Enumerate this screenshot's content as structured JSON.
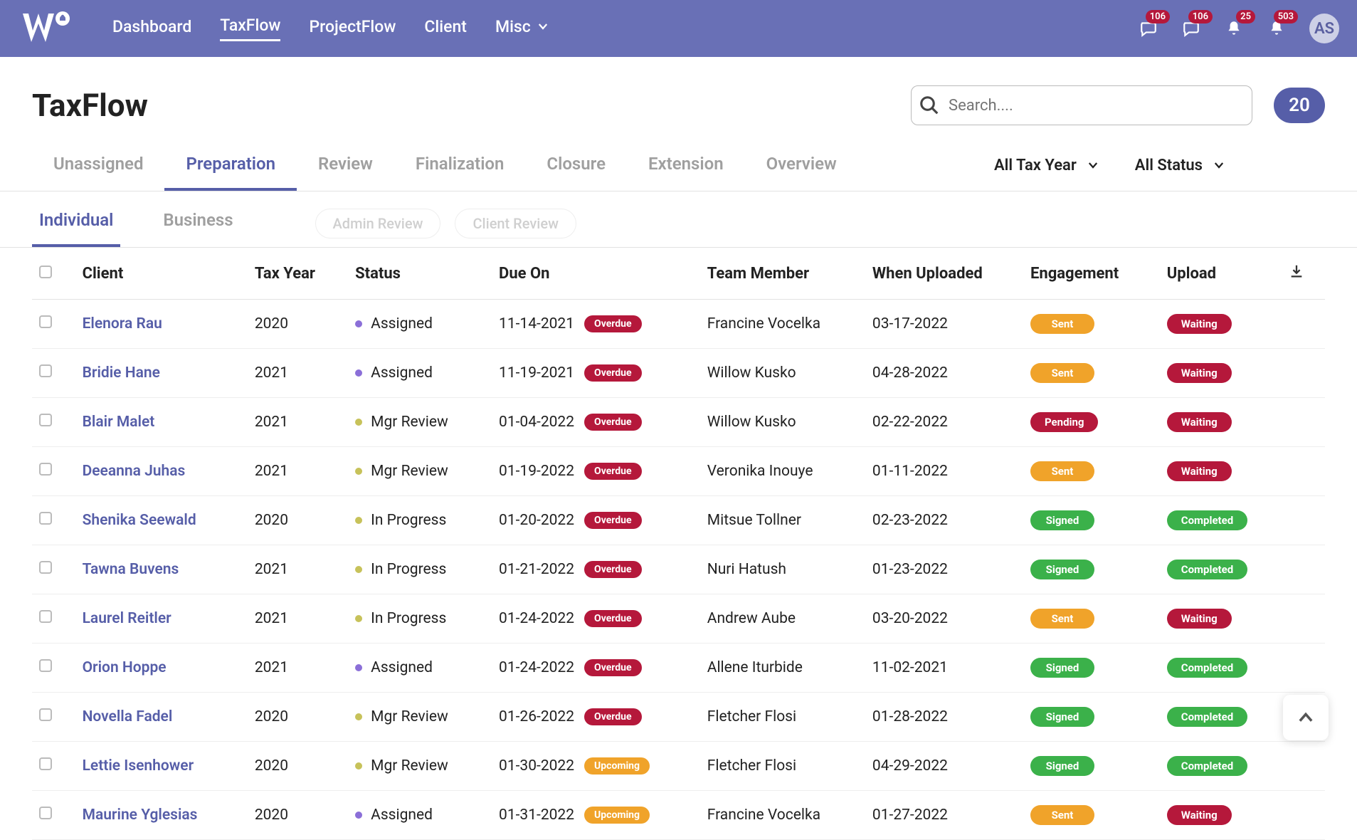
{
  "top": {
    "nav": [
      "Dashboard",
      "TaxFlow",
      "ProjectFlow",
      "Client",
      "Misc"
    ],
    "active": "TaxFlow",
    "badges": [
      {
        "icon": "chat-icon",
        "count": "106"
      },
      {
        "icon": "chat2-icon",
        "count": "106"
      },
      {
        "icon": "bell-icon",
        "count": "25"
      },
      {
        "icon": "bell2-icon",
        "count": "503"
      }
    ],
    "avatar": "AS"
  },
  "page": {
    "title": "TaxFlow",
    "search_placeholder": "Search....",
    "count": "20"
  },
  "mainTabs": [
    "Unassigned",
    "Preparation",
    "Review",
    "Finalization",
    "Closure",
    "Extension",
    "Overview"
  ],
  "mainActive": "Preparation",
  "filters": {
    "year": "All Tax Year",
    "status": "All Status"
  },
  "subTabs": [
    "Individual",
    "Business"
  ],
  "subActive": "Individual",
  "pillTabs": [
    "Admin Review",
    "Client Review"
  ],
  "columns": [
    "Client",
    "Tax Year",
    "Status",
    "Due On",
    "Team Member",
    "When Uploaded",
    "Engagement",
    "Upload"
  ],
  "badgeLabels": {
    "overdue": "Overdue",
    "upcoming": "Upcoming",
    "sent": "Sent",
    "pending": "Pending",
    "signed": "Signed",
    "waiting": "Waiting",
    "completed": "Completed"
  },
  "rows": [
    {
      "client": "Elenora Rau",
      "year": "2020",
      "status": "Assigned",
      "dot": "purple",
      "due": "11-14-2021",
      "dueBadge": "overdue",
      "member": "Francine Vocelka",
      "uploaded": "03-17-2022",
      "eng": "sent",
      "upl": "waiting"
    },
    {
      "client": "Bridie Hane",
      "year": "2021",
      "status": "Assigned",
      "dot": "purple",
      "due": "11-19-2021",
      "dueBadge": "overdue",
      "member": "Willow Kusko",
      "uploaded": "04-28-2022",
      "eng": "sent",
      "upl": "waiting"
    },
    {
      "client": "Blair Malet",
      "year": "2021",
      "status": "Mgr Review",
      "dot": "olive",
      "due": "01-04-2022",
      "dueBadge": "overdue",
      "member": "Willow Kusko",
      "uploaded": "02-22-2022",
      "eng": "pending",
      "upl": "waiting"
    },
    {
      "client": "Deeanna Juhas",
      "year": "2021",
      "status": "Mgr Review",
      "dot": "olive",
      "due": "01-19-2022",
      "dueBadge": "overdue",
      "member": "Veronika Inouye",
      "uploaded": "01-11-2022",
      "eng": "sent",
      "upl": "waiting"
    },
    {
      "client": "Shenika Seewald",
      "year": "2020",
      "status": "In Progress",
      "dot": "olive",
      "due": "01-20-2022",
      "dueBadge": "overdue",
      "member": "Mitsue Tollner",
      "uploaded": "02-23-2022",
      "eng": "signed",
      "upl": "completed"
    },
    {
      "client": "Tawna Buvens",
      "year": "2021",
      "status": "In Progress",
      "dot": "olive",
      "due": "01-21-2022",
      "dueBadge": "overdue",
      "member": "Nuri Hatush",
      "uploaded": "01-23-2022",
      "eng": "signed",
      "upl": "completed"
    },
    {
      "client": "Laurel Reitler",
      "year": "2021",
      "status": "In Progress",
      "dot": "olive",
      "due": "01-24-2022",
      "dueBadge": "overdue",
      "member": "Andrew Aube",
      "uploaded": "03-20-2022",
      "eng": "sent",
      "upl": "waiting"
    },
    {
      "client": "Orion Hoppe",
      "year": "2021",
      "status": "Assigned",
      "dot": "purple",
      "due": "01-24-2022",
      "dueBadge": "overdue",
      "member": "Allene Iturbide",
      "uploaded": "11-02-2021",
      "eng": "signed",
      "upl": "completed"
    },
    {
      "client": "Novella Fadel",
      "year": "2020",
      "status": "Mgr Review",
      "dot": "olive",
      "due": "01-26-2022",
      "dueBadge": "overdue",
      "member": "Fletcher Flosi",
      "uploaded": "01-28-2022",
      "eng": "signed",
      "upl": "completed"
    },
    {
      "client": "Lettie Isenhower",
      "year": "2020",
      "status": "Mgr Review",
      "dot": "olive",
      "due": "01-30-2022",
      "dueBadge": "upcoming",
      "member": "Fletcher Flosi",
      "uploaded": "04-29-2022",
      "eng": "signed",
      "upl": "completed"
    },
    {
      "client": "Maurine Yglesias",
      "year": "2020",
      "status": "Assigned",
      "dot": "purple",
      "due": "01-31-2022",
      "dueBadge": "upcoming",
      "member": "Francine Vocelka",
      "uploaded": "01-27-2022",
      "eng": "sent",
      "upl": "waiting"
    }
  ],
  "engClass": {
    "sent": "b-sent",
    "pending": "b-pending",
    "signed": "b-signed"
  },
  "uplClass": {
    "waiting": "b-waiting",
    "completed": "b-completed"
  }
}
